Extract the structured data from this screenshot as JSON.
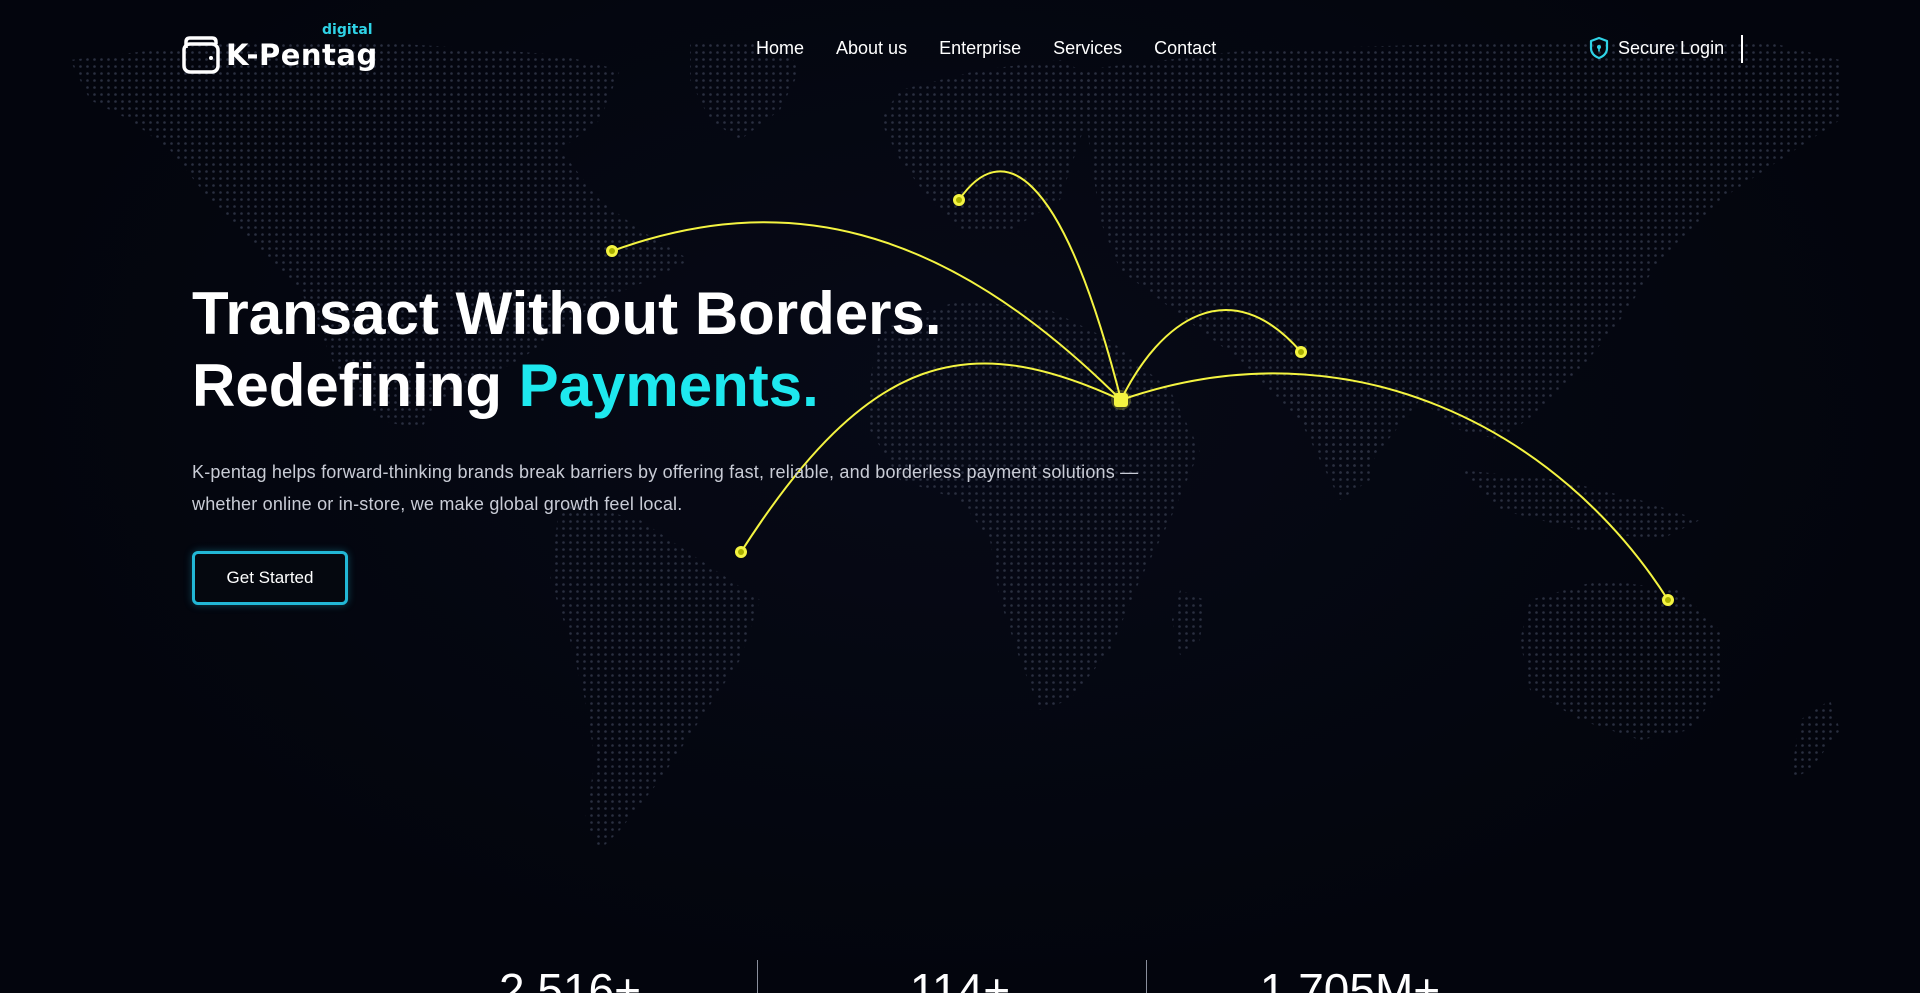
{
  "brand": {
    "name": "K-Pentag",
    "tagline": "digital",
    "accent_color": "#1ee8ee",
    "route_color": "#f4f441"
  },
  "nav": {
    "items": [
      {
        "label": "Home"
      },
      {
        "label": "About us"
      },
      {
        "label": "Enterprise"
      },
      {
        "label": "Services"
      },
      {
        "label": "Contact"
      }
    ],
    "secure_login": "Secure Login",
    "secure_login_icon": "shield-lock-icon"
  },
  "hero": {
    "title_line1": "Transact Without Borders.",
    "title_line2_prefix": "Redefining ",
    "title_line2_accent": "Payments.",
    "description": "K-pentag helps forward-thinking brands break barriers by offering fast, reliable, and borderless payment solutions — whether online or in-store, we make global growth feel local.",
    "cta_label": "Get Started"
  },
  "stats": [
    {
      "value": "2,516+"
    },
    {
      "value": "114+"
    },
    {
      "value": "1,705M+"
    }
  ]
}
